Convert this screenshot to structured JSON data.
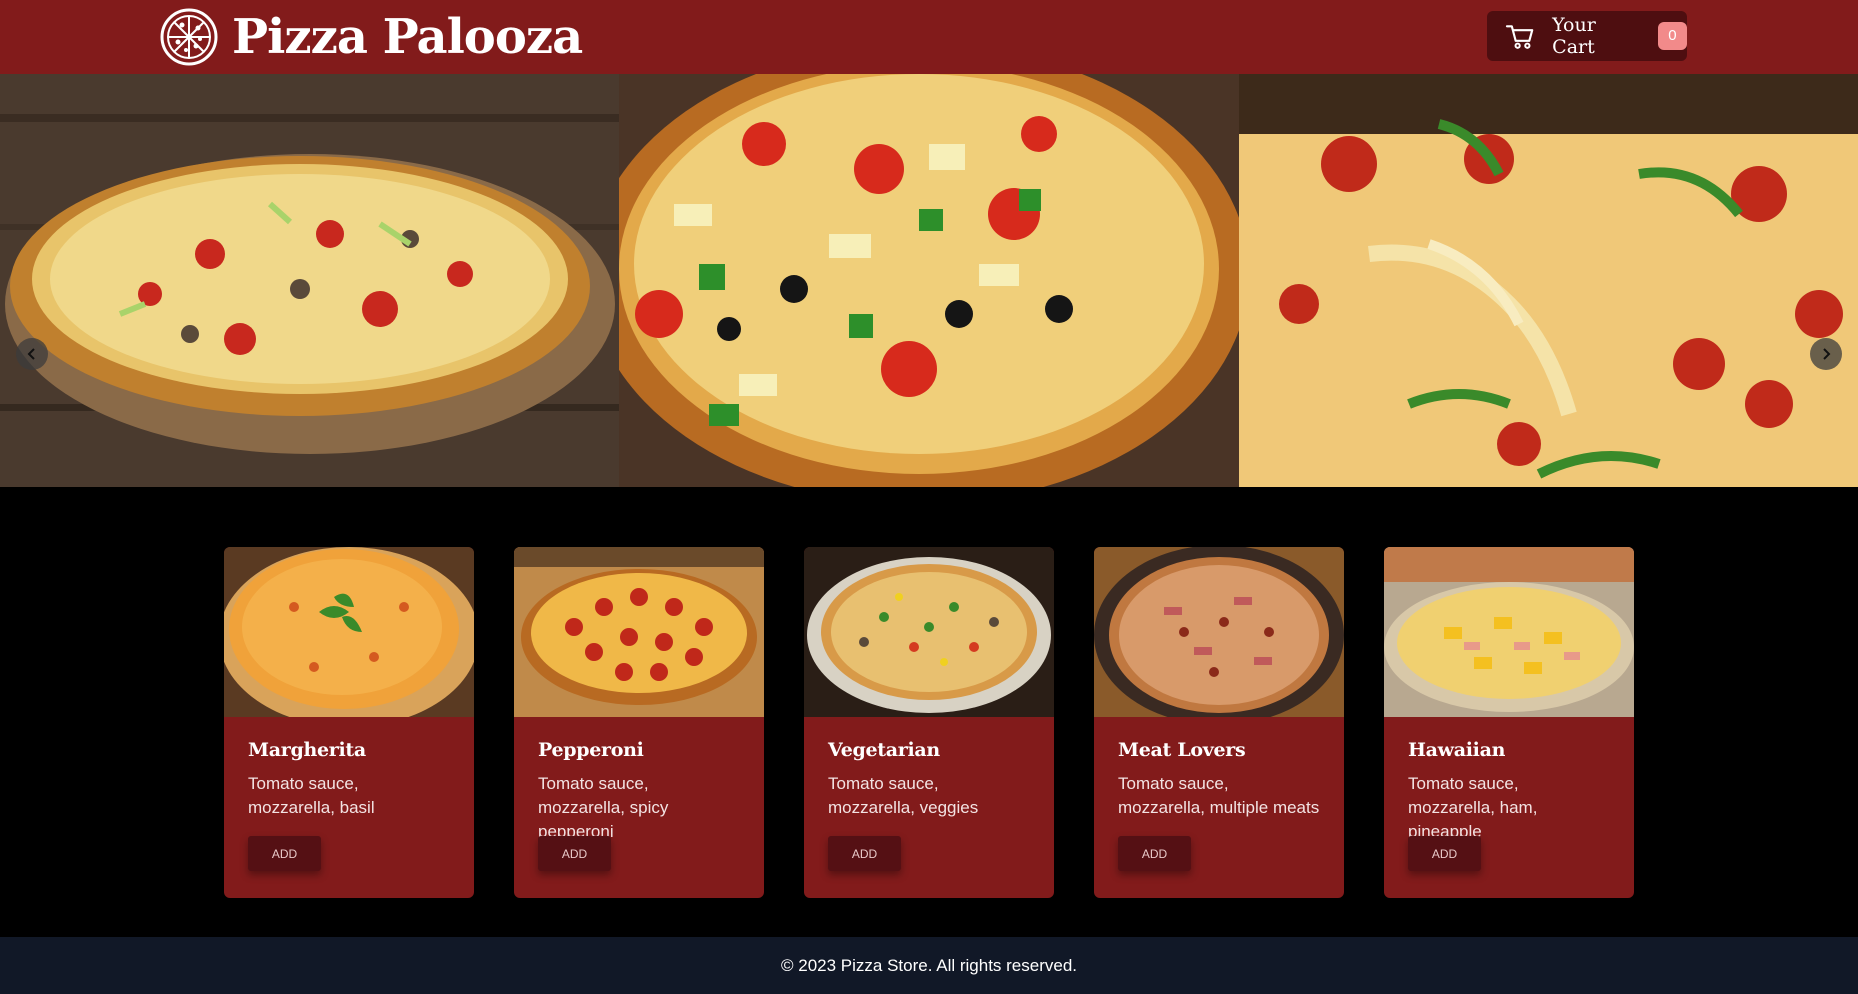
{
  "header": {
    "brand_title": "Pizza Palooza",
    "logo_icon": "pizza-icon",
    "cart_label": "Your Cart",
    "cart_count": "0",
    "cart_icon": "cart-icon"
  },
  "hero": {
    "slides": [
      {
        "label": "supreme pizza on wooden board"
      },
      {
        "label": "hawaiian pizza with olives and peppers"
      },
      {
        "label": "pepperoni pizza with cheese pull"
      }
    ],
    "prev_icon": "chevron-left-icon",
    "next_icon": "chevron-right-icon"
  },
  "menu": {
    "items": [
      {
        "name": "Margherita",
        "description": "Tomato sauce, mozzarella, basil",
        "button": "ADD"
      },
      {
        "name": "Pepperoni",
        "description": "Tomato sauce, mozzarella, spicy pepperoni",
        "button": "ADD"
      },
      {
        "name": "Vegetarian",
        "description": "Tomato sauce, mozzarella, veggies",
        "button": "ADD"
      },
      {
        "name": "Meat Lovers",
        "description": "Tomato sauce, mozzarella, multiple meats",
        "button": "ADD"
      },
      {
        "name": "Hawaiian",
        "description": "Tomato sauce, mozzarella, ham, pineapple",
        "button": "ADD"
      }
    ]
  },
  "footer": {
    "text": "© 2023 Pizza Store. All rights reserved."
  },
  "colors": {
    "header_bg": "#821b1b",
    "card_bg": "#821b1b",
    "button_bg": "#551014",
    "cart_badge": "#f28a8a",
    "footer_bg": "#111827",
    "page_bg": "#000000"
  }
}
